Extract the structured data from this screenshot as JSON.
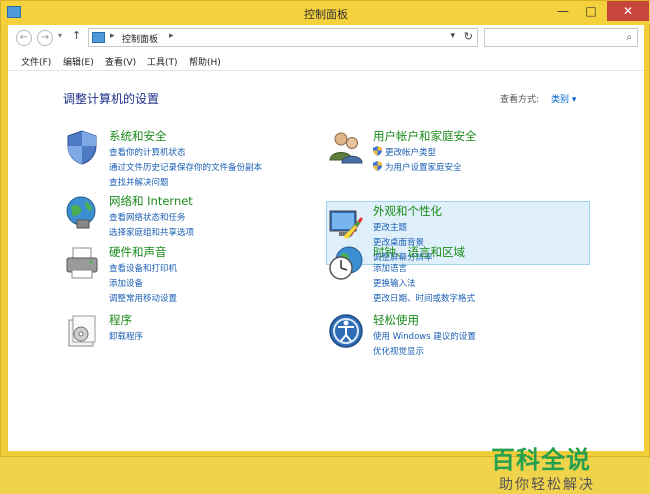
{
  "window": {
    "title": "控制面板",
    "minimize": "—",
    "maximize": "□",
    "close": "✕"
  },
  "nav": {
    "back": "←",
    "forward": "→",
    "recent": "▾",
    "up": "↑",
    "address_sep1": "▸",
    "address_text": "控制面板",
    "address_sep2": "▸",
    "address_dropdown": "▾",
    "refresh": "↻",
    "search_placeholder": "",
    "search_icon": "⌕"
  },
  "menu": [
    "文件(F)",
    "编辑(E)",
    "查看(V)",
    "工具(T)",
    "帮助(H)"
  ],
  "heading": "调整计算机的设置",
  "view_by": {
    "label": "查看方式:",
    "value": "类别 ▾"
  },
  "categories_left": [
    {
      "icon": "security-shield-icon",
      "title": "系统和安全",
      "links": [
        "查看你的计算机状态",
        "通过文件历史记录保存你的文件备份副本",
        "查找并解决问题"
      ]
    },
    {
      "icon": "network-globe-icon",
      "title": "网络和 Internet",
      "links": [
        "查看网络状态和任务",
        "选择家庭组和共享选项"
      ]
    },
    {
      "icon": "printer-icon",
      "title": "硬件和声音",
      "links": [
        "查看设备和打印机",
        "添加设备",
        "调整常用移动设置"
      ]
    },
    {
      "icon": "programs-icon",
      "title": "程序",
      "links": [
        "卸载程序"
      ]
    }
  ],
  "categories_right": [
    {
      "icon": "users-icon",
      "title": "用户帐户和家庭安全",
      "links": [
        "更改帐户类型",
        "为用户设置家庭安全"
      ]
    },
    {
      "icon": "appearance-icon",
      "title": "外观和个性化",
      "links": [
        "更改主题",
        "更改桌面背景",
        "调整屏幕分辨率"
      ]
    },
    {
      "icon": "clock-globe-icon",
      "title": "时钟、语言和区域",
      "links": [
        "添加语言",
        "更换输入法",
        "更改日期、时间或数字格式"
      ]
    },
    {
      "icon": "ease-of-access-icon",
      "title": "轻松使用",
      "links": [
        "使用 Windows 建议的设置",
        "优化视觉显示"
      ]
    }
  ],
  "watermark": {
    "line1": "百科全说",
    "line2": "助你轻松解决"
  },
  "colors": {
    "titlebar": "#f5d13d",
    "link": "#1a5fb4",
    "category_title": "#1a8a1a",
    "heading": "#1e3287",
    "highlight": "#e0f0fb"
  }
}
